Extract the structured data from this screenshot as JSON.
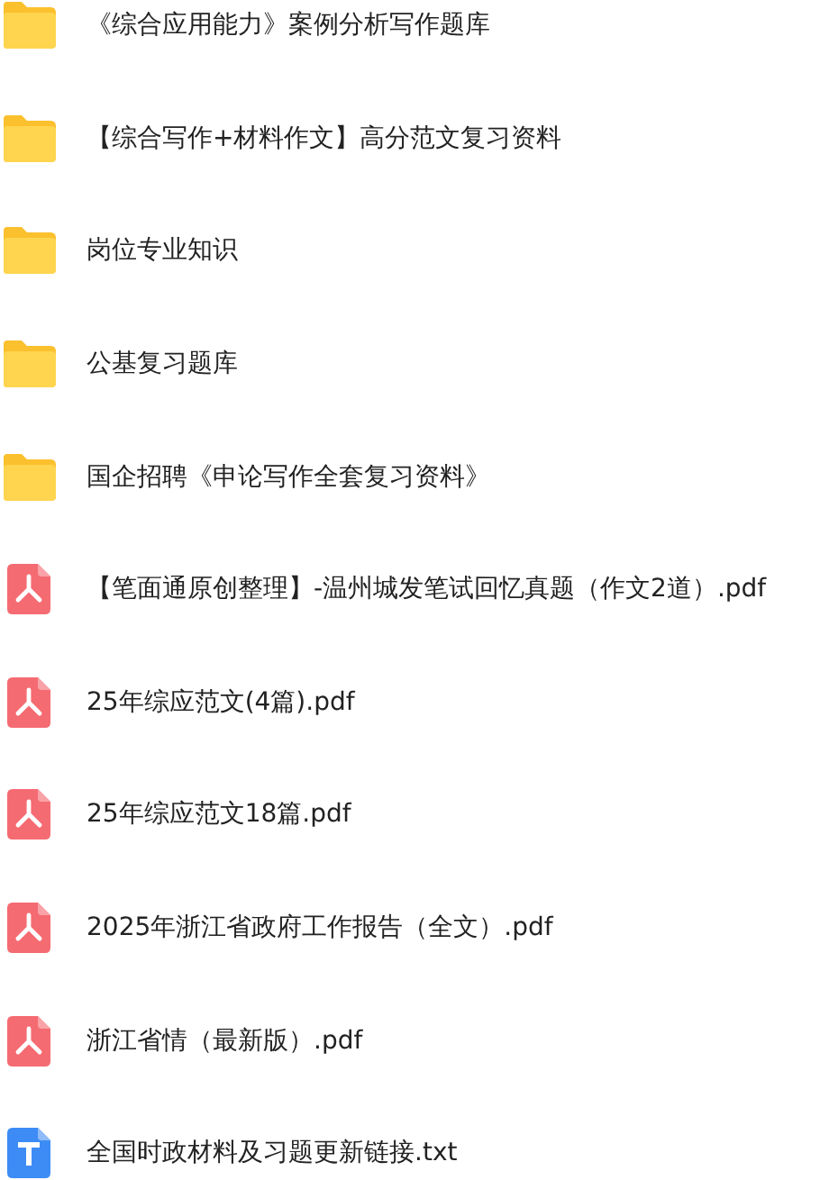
{
  "files": [
    {
      "kind": "folder",
      "name": "《综合应用能力》案例分析写作题库"
    },
    {
      "kind": "folder",
      "name": "【综合写作+材料作文】高分范文复习资料"
    },
    {
      "kind": "folder",
      "name": "岗位专业知识"
    },
    {
      "kind": "folder",
      "name": "公基复习题库"
    },
    {
      "kind": "folder",
      "name": "国企招聘《申论写作全套复习资料》"
    },
    {
      "kind": "pdf",
      "name": "【笔面通原创整理】-温州城发笔试回忆真题（作文2道）.pdf"
    },
    {
      "kind": "pdf",
      "name": "25年综应范文(4篇).pdf"
    },
    {
      "kind": "pdf",
      "name": "25年综应范文18篇.pdf"
    },
    {
      "kind": "pdf",
      "name": "2025年浙江省政府工作报告（全文）.pdf"
    },
    {
      "kind": "pdf",
      "name": "浙江省情（最新版）.pdf"
    },
    {
      "kind": "txt",
      "name": "全国时政材料及习题更新链接.txt"
    }
  ]
}
